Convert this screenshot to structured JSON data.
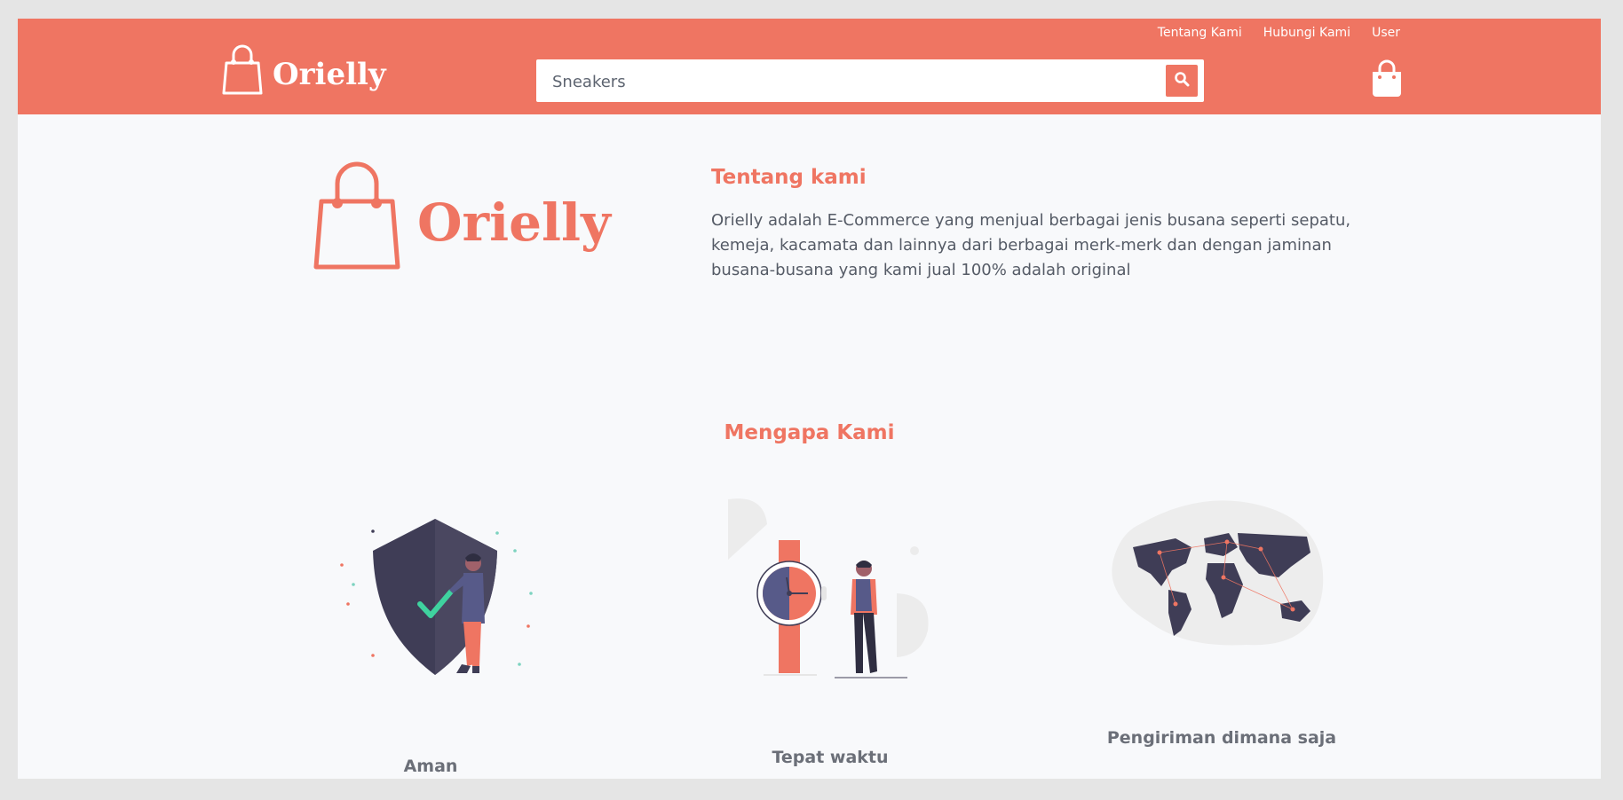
{
  "header": {
    "brand": "Orielly",
    "links": [
      "Tentang Kami",
      "Hubungi Kami",
      "User"
    ],
    "search": {
      "value": "Sneakers"
    }
  },
  "about": {
    "logo_text": "Orielly",
    "title": "Tentang kami",
    "body": "Orielly adalah E-Commerce yang menjual berbagai jenis busana seperti sepatu, kemeja, kacamata dan lainnya dari berbagai merk-merk dan dengan jaminan busana-busana yang kami jual 100% adalah original"
  },
  "why": {
    "title": "Mengapa Kami",
    "features": [
      {
        "label": "Aman"
      },
      {
        "label": "Tepat waktu"
      },
      {
        "label": "Pengiriman dimana saja"
      }
    ]
  },
  "colors": {
    "accent": "#ef7562",
    "dark": "#3f3d56",
    "text": "#555b66",
    "bg": "#f8f9fb"
  },
  "icons": [
    "shopping-bag-icon",
    "search-icon",
    "cart-icon"
  ]
}
